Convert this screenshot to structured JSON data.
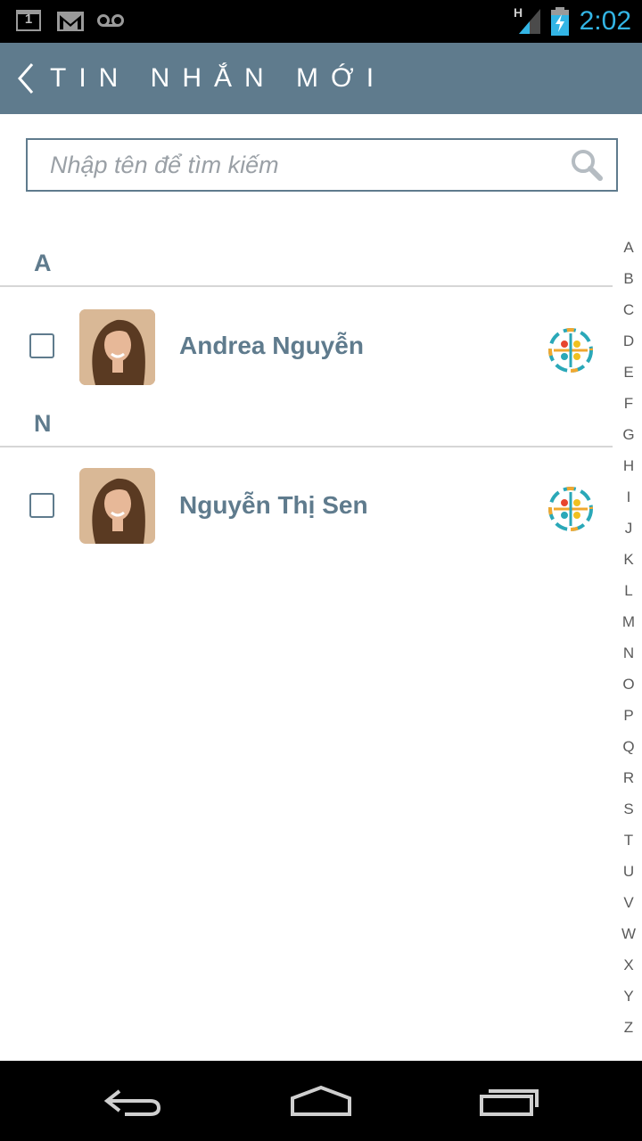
{
  "status_bar": {
    "calendar_day": "1",
    "network_type": "H",
    "time": "2:02",
    "icons": [
      "calendar-icon",
      "gmail-icon",
      "voicemail-icon",
      "signal-icon",
      "battery-charging-icon"
    ]
  },
  "header": {
    "title": "TIN NHẮN MỚI"
  },
  "search": {
    "placeholder": "Nhập tên để tìm kiếm"
  },
  "sections": [
    {
      "letter": "A",
      "contacts": [
        {
          "name": "Andrea Nguyễn"
        }
      ]
    },
    {
      "letter": "N",
      "contacts": [
        {
          "name": "Nguyễn Thị Sen"
        }
      ]
    }
  ],
  "alphabet_index": [
    "A",
    "B",
    "C",
    "D",
    "E",
    "F",
    "G",
    "H",
    "I",
    "J",
    "K",
    "L",
    "M",
    "N",
    "O",
    "P",
    "Q",
    "R",
    "S",
    "T",
    "U",
    "V",
    "W",
    "X",
    "Y",
    "Z"
  ],
  "colors": {
    "accent": "#5f7b8d",
    "status_time": "#33b5e5"
  }
}
